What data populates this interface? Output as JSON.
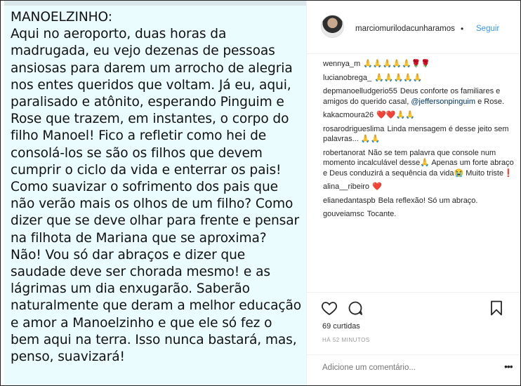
{
  "image": {
    "top_text": "",
    "heading": "MANOELZINHO:",
    "body": "Aqui no aeroporto, duas horas da\nmadrugada, eu vejo dezenas de pessoas\nansiosas para darem um arrocho de alegria\nnos entes queridos que voltam.  Já eu, aqui,\nparalisado e atônito,  esperando Pinguim e\nRose que trazem, em instantes, o corpo do\nfilho Manoel! Fico a refletir como hei de\nconsolá-los se são os filhos que devem\ncumprir o ciclo da vida e enterrar os pais!\nComo suavizar o sofrimento dos pais que\nnão verão mais os olhos de um filho? Como\ndizer que se deve olhar para frente e pensar\nna filhota de Mariana que se aproxima?\nNão! Vou só dar abraços e dizer que\nsaudade deve ser chorada mesmo! e as\nlágrimas um dia enxugarão. Saberão\nnaturalmente que deram a melhor educação\ne amor a Manoelzinho e que ele só fez o\nbem aqui na terra. Isso nunca bastará, mas,\npenso, suavizará!"
  },
  "header": {
    "username": "marciomurilodacunharamos",
    "separator": "•",
    "follow_label": "Seguir"
  },
  "comments": [
    {
      "user": "wennya_m",
      "text": "",
      "emojis": "🙏🙏🙏🙏🙏🌹🌹"
    },
    {
      "user": "lucianobrega_",
      "text": "",
      "emojis": "🙏🙏🙏🙏🙏"
    },
    {
      "user": "depmanoelludgerio55",
      "text": "Deus conforte os familiares e amigos do querido casal,",
      "mention": "@jeffersonpinguim",
      "text_after": " e Rose."
    },
    {
      "user": "kakacmoura26",
      "text": "",
      "emojis": "❤️❤️🙏🙏"
    },
    {
      "user": "rosarodrigueslima",
      "text": "Linda mensagem é desse jeito sem palavras... ",
      "emojis": "🙏🙏"
    },
    {
      "user": "robertanorat",
      "text": "Não se tem palavra que console num momento incalculável desse🙏 Apenas um forte abraço e Deus conduzirá a sequência da vida😭 Muito triste❗"
    },
    {
      "user": "alina__ribeiro",
      "text": "",
      "emojis": "❤️"
    },
    {
      "user": "elianedantaspb",
      "text": "Bela reflexão! Só um abraço."
    },
    {
      "user": "gouveiamsc",
      "text": "Tocante."
    }
  ],
  "actions": {
    "likes": "69 curtidas",
    "time": "HÁ 52 MINUTOS",
    "add_comment_placeholder": "Adicione um comentário...",
    "more": "•••"
  },
  "icons": {
    "like": "heart-outline-icon",
    "comment": "comment-bubble-icon",
    "save": "bookmark-icon"
  }
}
